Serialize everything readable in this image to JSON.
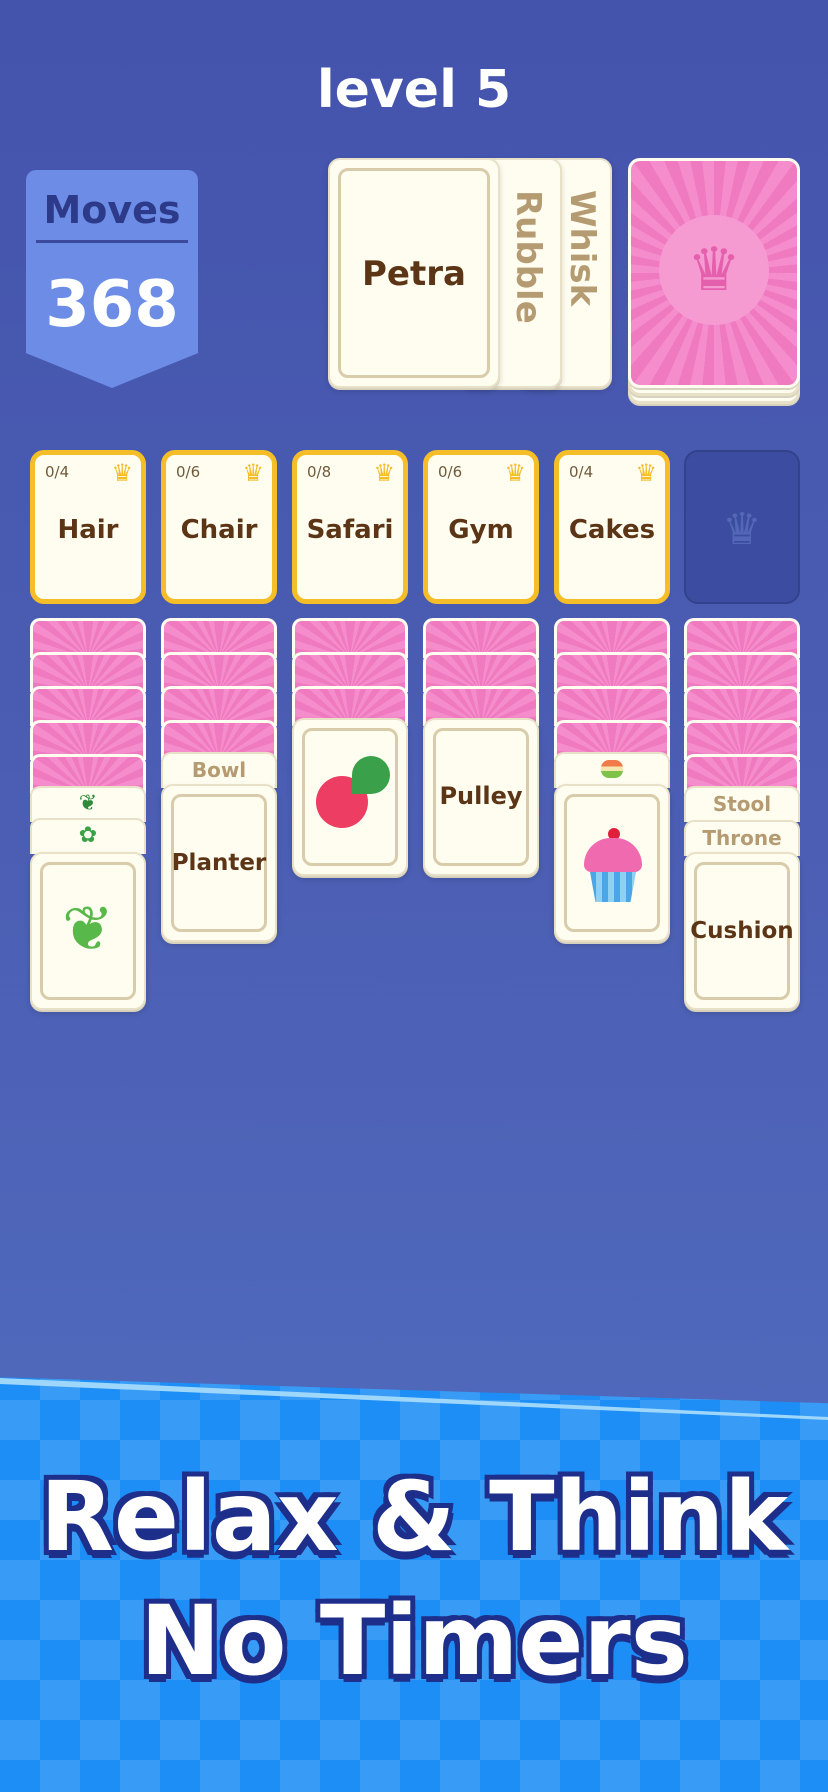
{
  "header": {
    "title": "level 5"
  },
  "moves": {
    "label": "Moves",
    "count": "368"
  },
  "waste": {
    "top": "Petra",
    "second": "Rubble",
    "third": "Whisk"
  },
  "foundations": [
    {
      "count": "0/4",
      "name": "Hair"
    },
    {
      "count": "0/6",
      "name": "Chair"
    },
    {
      "count": "0/8",
      "name": "Safari"
    },
    {
      "count": "0/6",
      "name": "Gym"
    },
    {
      "count": "0/4",
      "name": "Cakes"
    }
  ],
  "columns": {
    "col2": {
      "tab": "Bowl",
      "card": "Planter"
    },
    "col4": {
      "card": "Pulley"
    },
    "col6": {
      "tab1": "Stool",
      "tab2": "Throne",
      "card": "Cushion"
    }
  },
  "icons": {
    "crown": "jester-hat-icon",
    "herb": "dill-icon",
    "radish": "radish-icon",
    "cupcake": "cupcake-icon",
    "macaron": "macaron-icon"
  },
  "banner": {
    "line1": "Relax & Think",
    "line2": "No Timers"
  }
}
